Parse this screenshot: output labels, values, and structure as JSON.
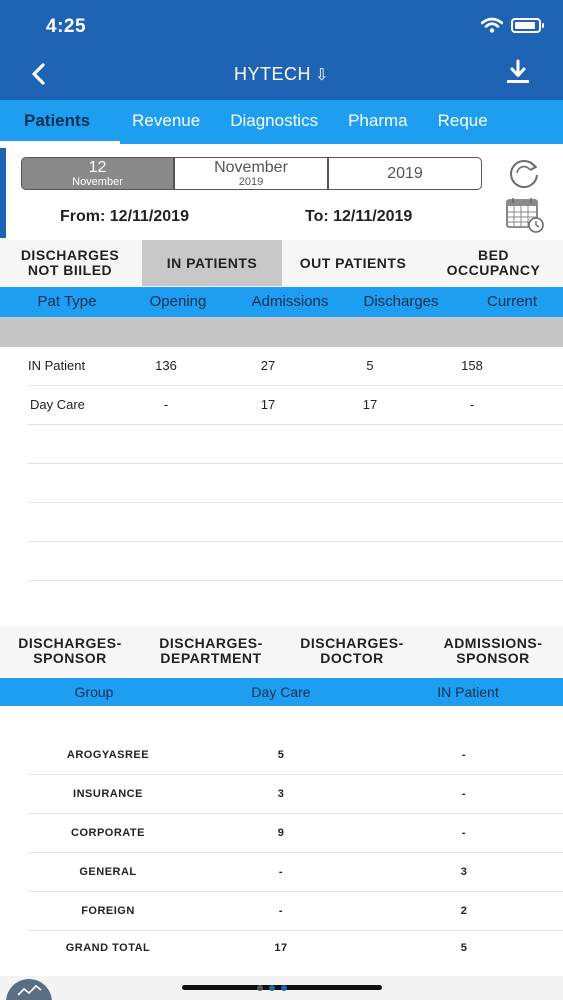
{
  "status": {
    "time": "4:25"
  },
  "nav": {
    "title": "HYTECH",
    "title_arrow": "⇩"
  },
  "tabs": [
    "Patients",
    "Revenue",
    "Diagnostics",
    "Pharma",
    "Reque"
  ],
  "date": {
    "day": "12",
    "day_month": "November",
    "month": "November",
    "month_year": "2019",
    "year": "2019",
    "from": "From: 12/11/2019",
    "to": "To: 12/11/2019"
  },
  "subtabs": [
    {
      "label": "DISCHARGES\nNOT BIILED"
    },
    {
      "label": "IN PATIENTS"
    },
    {
      "label": "OUT PATIENTS"
    },
    {
      "label": "BED\nOCCUPANCY"
    }
  ],
  "table1": {
    "headers": [
      "Pat Type",
      "Opening",
      "Admissions",
      "Discharges",
      "Current"
    ],
    "rows": [
      [
        "IN Patient",
        "136",
        "27",
        "5",
        "158"
      ],
      [
        "Day Care",
        "-",
        "17",
        "17",
        "-"
      ]
    ]
  },
  "subtabs2": [
    {
      "label": "DISCHARGES-\nSPONSOR"
    },
    {
      "label": "DISCHARGES-\nDEPARTMENT"
    },
    {
      "label": "DISCHARGES-\nDOCTOR"
    },
    {
      "label": "ADMISSIONS-\nSPONSOR"
    }
  ],
  "table2": {
    "headers": [
      "Group",
      "Day Care",
      "IN Patient"
    ],
    "rows": [
      [
        "AROGYASREE",
        "5",
        "-"
      ],
      [
        "INSURANCE",
        "3",
        "-"
      ],
      [
        "CORPORATE",
        "9",
        "-"
      ],
      [
        "GENERAL",
        "-",
        "3"
      ],
      [
        "FOREIGN",
        "-",
        "2"
      ],
      [
        "GRAND TOTAL",
        "17",
        "5"
      ]
    ]
  },
  "colors": {
    "primary": "#1f64b4",
    "accent": "#1e9ef0",
    "active_tab_text": "#0b2f55",
    "selected_segment": "#8a8a8a"
  },
  "icons": {
    "back": "chevron-left-icon",
    "download": "download-icon",
    "refresh": "refresh-icon",
    "calendar": "calendar-icon",
    "chart": "chart-icon"
  }
}
